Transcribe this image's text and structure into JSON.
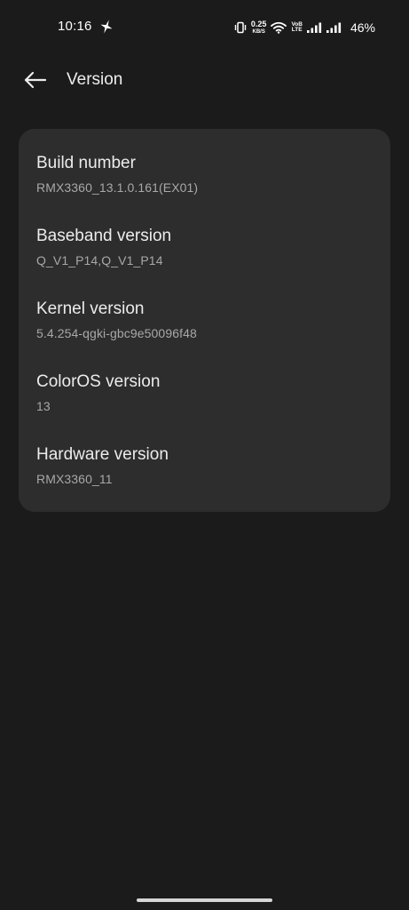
{
  "status_bar": {
    "time": "10:16",
    "network_speed_value": "0.25",
    "network_speed_unit": "KB/S",
    "volte_top": "VoB",
    "volte_bottom": "LTE",
    "battery_percent": "46%"
  },
  "app_bar": {
    "title": "Version"
  },
  "version_items": [
    {
      "label": "Build number",
      "value": "RMX3360_13.1.0.161(EX01)"
    },
    {
      "label": "Baseband version",
      "value": "Q_V1_P14,Q_V1_P14"
    },
    {
      "label": "Kernel version",
      "value": "5.4.254-qgki-gbc9e50096f48"
    },
    {
      "label": "ColorOS version",
      "value": "13"
    },
    {
      "label": "Hardware version",
      "value": "RMX3360_11"
    }
  ],
  "icons": {
    "back": "arrow-left-icon",
    "sparkle": "sparkle-icon",
    "vibrate": "vibrate-icon",
    "wifi": "wifi-icon",
    "signal": "signal-icon"
  },
  "colors": {
    "background": "#1b1b1b",
    "card": "#2d2d2d",
    "primary_text": "#ececec",
    "secondary_text": "#a8a8a8"
  }
}
